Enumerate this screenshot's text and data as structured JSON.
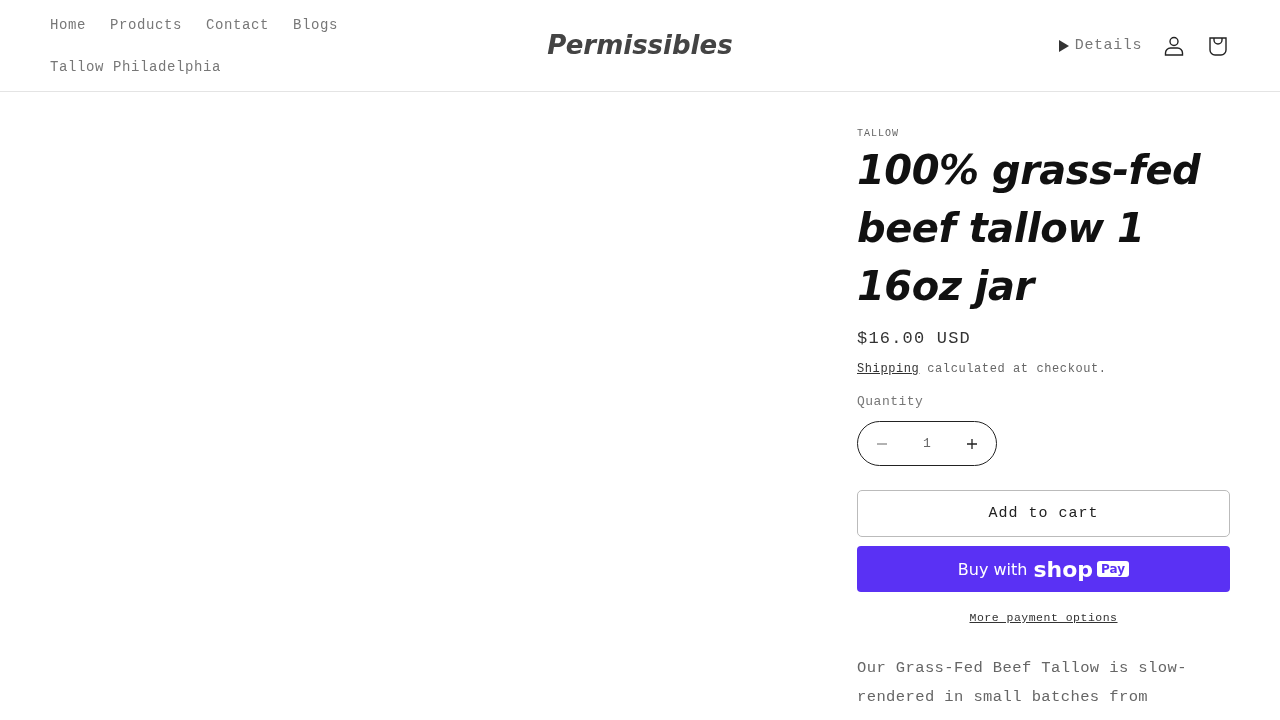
{
  "header": {
    "nav": [
      {
        "label": "Home"
      },
      {
        "label": "Products"
      },
      {
        "label": "Contact"
      },
      {
        "label": "Blogs"
      },
      {
        "label": "Tallow Philadelphia"
      }
    ],
    "logo": "Permissibles",
    "details": {
      "label": "Details",
      "expanded": false
    }
  },
  "product": {
    "vendor": "TALLOW",
    "title": "100% grass-fed beef tallow 1 16oz jar",
    "price": "$16.00 USD",
    "shipping_link": "Shipping",
    "shipping_note": "calculated at checkout.",
    "quantity": {
      "label": "Quantity",
      "value": "1"
    },
    "add_to_cart": "Add to cart",
    "buy_with": "Buy with",
    "shop": "shop",
    "pay": "Pay",
    "more_options": "More payment options",
    "description": "Our Grass-Fed Beef Tallow is slow-rendered in small batches from"
  }
}
